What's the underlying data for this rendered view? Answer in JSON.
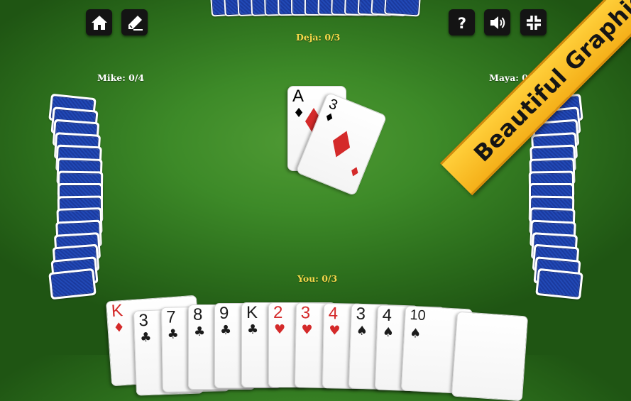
{
  "toolbar": {
    "home_icon": "home-icon",
    "edit_icon": "pencil-icon",
    "help_icon": "help-icon",
    "sound_icon": "speaker-icon",
    "fullscreen_icon": "collapse-icon"
  },
  "players": {
    "top": {
      "score": "Deja: 0/3"
    },
    "left": {
      "score": "Mike: 0/4"
    },
    "right": {
      "score": "Maya: 0/1"
    },
    "bottom": {
      "score": "You: 0/3"
    }
  },
  "trick": [
    {
      "rank": "A",
      "suit": "♦",
      "color": "red"
    },
    {
      "rank": "3",
      "suit": "♦",
      "color": "red"
    }
  ],
  "hand": [
    {
      "rank": "K",
      "suit": "♦",
      "color": "red"
    },
    {
      "rank": "3",
      "suit": "♣",
      "color": "black"
    },
    {
      "rank": "7",
      "suit": "♣",
      "color": "black"
    },
    {
      "rank": "8",
      "suit": "♣",
      "color": "black"
    },
    {
      "rank": "9",
      "suit": "♣",
      "color": "black"
    },
    {
      "rank": "K",
      "suit": "♣",
      "color": "black"
    },
    {
      "rank": "2",
      "suit": "♥",
      "color": "red"
    },
    {
      "rank": "3",
      "suit": "♥",
      "color": "red"
    },
    {
      "rank": "4",
      "suit": "♥",
      "color": "red"
    },
    {
      "rank": "3",
      "suit": "♠",
      "color": "black"
    },
    {
      "rank": "4",
      "suit": "♠",
      "color": "black"
    },
    {
      "rank": "10",
      "suit": "♠",
      "color": "black"
    },
    {
      "rank": "",
      "suit": "",
      "color": "black"
    }
  ],
  "banner": {
    "text": "Beautiful Graphics"
  },
  "colors": {
    "felt": "#3d8a28",
    "card_back": "#1f45b0",
    "banner": "#f8c22a",
    "score_you": "#f6d84a"
  }
}
